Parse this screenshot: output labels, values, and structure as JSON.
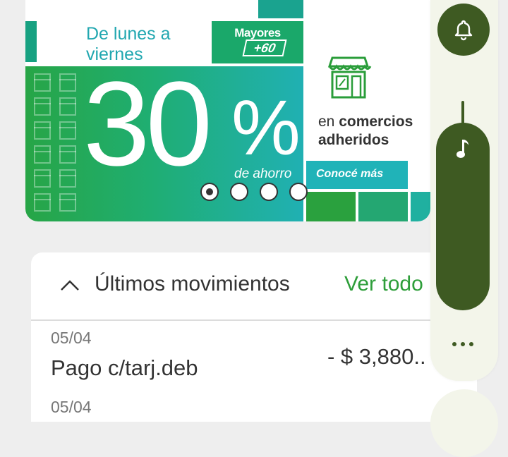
{
  "banner": {
    "days_line1": "De lunes a",
    "days_line2": "viernes",
    "mayores": "Mayores",
    "plus60": "+60",
    "big_number": "30",
    "percent": "%",
    "savings": "de ahorro",
    "comercios_prefix": "en",
    "comercios_bold": "comercios",
    "adheridos": "adheridos",
    "cta": "Conocé más"
  },
  "carousel": {
    "total": 4,
    "active_index": 0
  },
  "movements": {
    "title": "Últimos movimientos",
    "view_all": "Ver todo",
    "rows": [
      {
        "date": "05/04",
        "description": "Pago c/tarj.deb",
        "amount": "-  $ 3,880.."
      },
      {
        "date": "05/04"
      }
    ]
  },
  "side_panel": {
    "bell_icon": "bell-icon",
    "music_icon": "music-note-icon",
    "more_icon": "more-horizontal-icon"
  },
  "colors": {
    "accent_green": "#2e9e3a",
    "panel_dark_green": "#3e5a22",
    "teal": "#20b3b8"
  }
}
